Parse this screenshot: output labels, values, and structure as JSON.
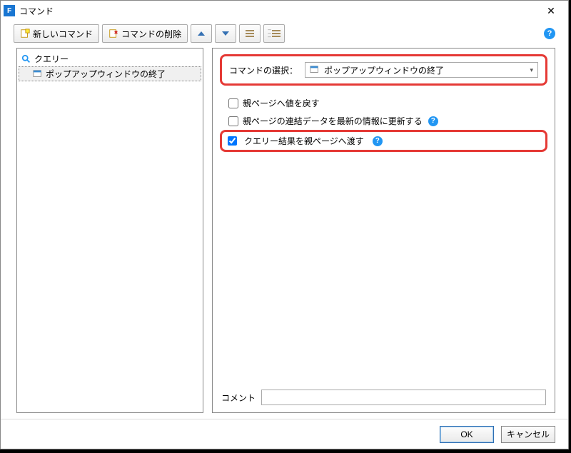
{
  "title": "コマンド",
  "toolbar": {
    "new_command": "新しいコマンド",
    "delete_command": "コマンドの削除"
  },
  "tree": {
    "root": "クエリー",
    "child": "ポップアップウィンドウの終了"
  },
  "form": {
    "command_select_label": "コマンドの選択：",
    "command_select_value": "ポップアップウィンドウの終了",
    "checkbox1": "親ページへ値を戻す",
    "checkbox2": "親ページの連結データを最新の情報に更新する",
    "checkbox3": "クエリー結果を親ページへ渡す",
    "checkbox1_checked": false,
    "checkbox2_checked": false,
    "checkbox3_checked": true,
    "comment_label": "コメント",
    "comment_value": ""
  },
  "footer": {
    "ok": "OK",
    "cancel": "キャンセル"
  }
}
